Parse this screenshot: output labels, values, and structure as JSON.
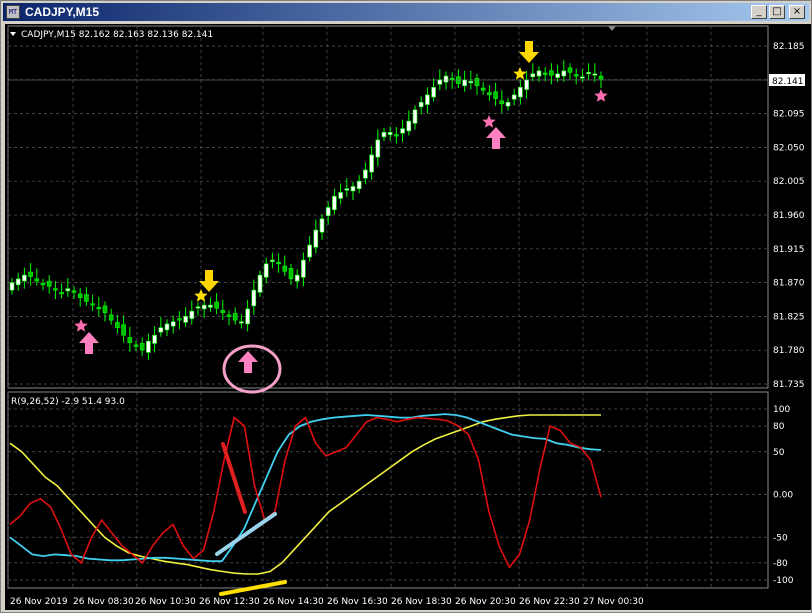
{
  "window": {
    "title": "CADJPY,M15",
    "icon_name": "chart-window-icon",
    "buttons": [
      {
        "name": "minimize-button",
        "glyph": "_"
      },
      {
        "name": "maximize-button",
        "glyph": "□"
      },
      {
        "name": "close-button",
        "glyph": "×"
      }
    ]
  },
  "price_panel": {
    "header": "CADJPY,M15  82.162 82.163 82.136 82.141",
    "current_price": "82.141",
    "y_ticks": [
      "82.185",
      "82.140",
      "82.095",
      "82.050",
      "82.005",
      "81.960",
      "81.915",
      "81.870",
      "81.825",
      "81.780",
      "81.735"
    ]
  },
  "indicator_panel": {
    "header": "R(9,26,52) -2.9 51.4 93.0",
    "y_ticks": [
      "100",
      "80",
      "50",
      "0.00",
      "-50",
      "-80",
      "-100"
    ]
  },
  "x_ticks": [
    "26 Nov 2019",
    "26 Nov 08:30",
    "26 Nov 10:30",
    "26 Nov 12:30",
    "26 Nov 14:30",
    "26 Nov 16:30",
    "26 Nov 18:30",
    "26 Nov 20:30",
    "26 Nov 22:30",
    "27 Nov 00:30"
  ],
  "colors": {
    "background": "#000000",
    "grid": "#5a5a5a",
    "bull_candle": "#ffffff",
    "bear_candle": "#00c000",
    "wick": "#00ff00",
    "signal_star_yellow": "#ffe000",
    "signal_star_pink": "#ff6fb0",
    "arrow_up": "#ff80c0",
    "arrow_down": "#ffd700",
    "line_red": "#e01010",
    "line_cyan": "#40d0f0",
    "line_yellow": "#f0f040"
  },
  "chart_data": {
    "type": "candlestick",
    "symbol": "CADJPY",
    "timeframe": "M15",
    "ylim_price": [
      81.735,
      82.2
    ],
    "ylim_indicator": [
      -100,
      100
    ],
    "price_path": [
      81.87,
      81.875,
      81.88,
      81.878,
      81.872,
      81.868,
      81.865,
      81.86,
      81.855,
      81.862,
      81.858,
      81.85,
      81.845,
      81.84,
      81.835,
      81.83,
      81.82,
      81.81,
      81.8,
      81.79,
      81.785,
      81.78,
      81.792,
      81.8,
      81.81,
      81.815,
      81.818,
      81.82,
      81.825,
      81.832,
      81.838,
      81.84,
      81.84,
      81.836,
      81.83,
      81.825,
      81.82,
      81.818,
      81.835,
      81.86,
      81.88,
      81.895,
      81.9,
      81.895,
      81.885,
      81.875,
      81.88,
      81.9,
      81.92,
      81.94,
      81.955,
      81.97,
      81.985,
      81.99,
      81.995,
      81.998,
      82.005,
      82.02,
      82.04,
      82.06,
      82.07,
      82.07,
      82.065,
      82.075,
      82.085,
      82.1,
      82.11,
      82.12,
      82.13,
      82.14,
      82.145,
      82.14,
      82.135,
      82.14,
      82.138,
      82.132,
      82.126,
      82.12,
      82.115,
      82.108,
      82.11,
      82.12,
      82.13,
      82.14,
      82.148,
      82.152,
      82.148,
      82.146,
      82.148,
      82.152,
      82.15,
      82.146,
      82.144,
      82.15,
      82.148,
      82.141
    ],
    "indicator_red": [
      -35,
      -25,
      -10,
      -5,
      -15,
      -40,
      -70,
      -80,
      -50,
      -30,
      -45,
      -60,
      -70,
      -80,
      -60,
      -45,
      -35,
      -60,
      -75,
      -65,
      -20,
      40,
      90,
      80,
      10,
      -30,
      -20,
      40,
      80,
      90,
      60,
      45,
      50,
      55,
      70,
      85,
      90,
      88,
      85,
      88,
      90,
      89,
      88,
      86,
      80,
      70,
      40,
      -20,
      -60,
      -85,
      -70,
      -30,
      30,
      80,
      75,
      60,
      55,
      40,
      -3
    ],
    "indicator_cyan": [
      -50,
      -60,
      -70,
      -72,
      -70,
      -71,
      -72,
      -75,
      -76,
      -77,
      -77,
      -76,
      -75,
      -74,
      -74,
      -75,
      -76,
      -77,
      -78,
      -78,
      -60,
      -40,
      -10,
      20,
      50,
      70,
      80,
      85,
      88,
      90,
      91,
      92,
      93,
      92,
      91,
      90,
      90,
      92,
      93,
      94,
      93,
      90,
      85,
      80,
      75,
      70,
      68,
      66,
      65,
      60,
      58,
      55,
      53,
      52
    ],
    "indicator_yellow": [
      60,
      50,
      35,
      20,
      10,
      -5,
      -20,
      -35,
      -50,
      -60,
      -68,
      -72,
      -75,
      -78,
      -80,
      -82,
      -85,
      -88,
      -90,
      -92,
      -93,
      -93,
      -90,
      -80,
      -65,
      -50,
      -35,
      -20,
      -10,
      0,
      10,
      20,
      30,
      40,
      50,
      58,
      65,
      70,
      75,
      80,
      85,
      88,
      90,
      92,
      93,
      93,
      93,
      93,
      93,
      93,
      93
    ]
  }
}
